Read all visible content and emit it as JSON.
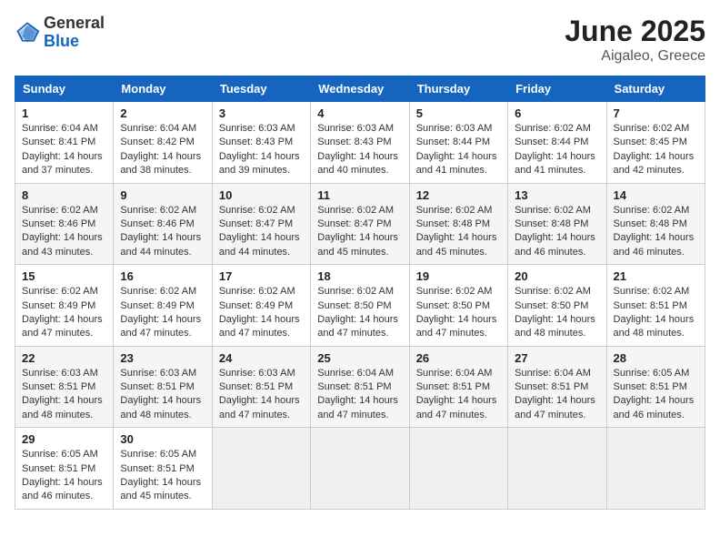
{
  "header": {
    "logo_general": "General",
    "logo_blue": "Blue",
    "month_year": "June 2025",
    "location": "Aigaleo, Greece"
  },
  "calendar": {
    "days_of_week": [
      "Sunday",
      "Monday",
      "Tuesday",
      "Wednesday",
      "Thursday",
      "Friday",
      "Saturday"
    ],
    "weeks": [
      [
        null,
        {
          "day": "2",
          "sunrise": "6:04 AM",
          "sunset": "8:42 PM",
          "daylight": "14 hours and 38 minutes."
        },
        {
          "day": "3",
          "sunrise": "6:03 AM",
          "sunset": "8:43 PM",
          "daylight": "14 hours and 39 minutes."
        },
        {
          "day": "4",
          "sunrise": "6:03 AM",
          "sunset": "8:43 PM",
          "daylight": "14 hours and 40 minutes."
        },
        {
          "day": "5",
          "sunrise": "6:03 AM",
          "sunset": "8:44 PM",
          "daylight": "14 hours and 41 minutes."
        },
        {
          "day": "6",
          "sunrise": "6:02 AM",
          "sunset": "8:44 PM",
          "daylight": "14 hours and 41 minutes."
        },
        {
          "day": "7",
          "sunrise": "6:02 AM",
          "sunset": "8:45 PM",
          "daylight": "14 hours and 42 minutes."
        }
      ],
      [
        {
          "day": "1",
          "sunrise": "6:04 AM",
          "sunset": "8:41 PM",
          "daylight": "14 hours and 37 minutes."
        },
        null,
        null,
        null,
        null,
        null,
        null
      ],
      [
        {
          "day": "8",
          "sunrise": "6:02 AM",
          "sunset": "8:46 PM",
          "daylight": "14 hours and 43 minutes."
        },
        {
          "day": "9",
          "sunrise": "6:02 AM",
          "sunset": "8:46 PM",
          "daylight": "14 hours and 44 minutes."
        },
        {
          "day": "10",
          "sunrise": "6:02 AM",
          "sunset": "8:47 PM",
          "daylight": "14 hours and 44 minutes."
        },
        {
          "day": "11",
          "sunrise": "6:02 AM",
          "sunset": "8:47 PM",
          "daylight": "14 hours and 45 minutes."
        },
        {
          "day": "12",
          "sunrise": "6:02 AM",
          "sunset": "8:48 PM",
          "daylight": "14 hours and 45 minutes."
        },
        {
          "day": "13",
          "sunrise": "6:02 AM",
          "sunset": "8:48 PM",
          "daylight": "14 hours and 46 minutes."
        },
        {
          "day": "14",
          "sunrise": "6:02 AM",
          "sunset": "8:48 PM",
          "daylight": "14 hours and 46 minutes."
        }
      ],
      [
        {
          "day": "15",
          "sunrise": "6:02 AM",
          "sunset": "8:49 PM",
          "daylight": "14 hours and 47 minutes."
        },
        {
          "day": "16",
          "sunrise": "6:02 AM",
          "sunset": "8:49 PM",
          "daylight": "14 hours and 47 minutes."
        },
        {
          "day": "17",
          "sunrise": "6:02 AM",
          "sunset": "8:49 PM",
          "daylight": "14 hours and 47 minutes."
        },
        {
          "day": "18",
          "sunrise": "6:02 AM",
          "sunset": "8:50 PM",
          "daylight": "14 hours and 47 minutes."
        },
        {
          "day": "19",
          "sunrise": "6:02 AM",
          "sunset": "8:50 PM",
          "daylight": "14 hours and 47 minutes."
        },
        {
          "day": "20",
          "sunrise": "6:02 AM",
          "sunset": "8:50 PM",
          "daylight": "14 hours and 48 minutes."
        },
        {
          "day": "21",
          "sunrise": "6:02 AM",
          "sunset": "8:51 PM",
          "daylight": "14 hours and 48 minutes."
        }
      ],
      [
        {
          "day": "22",
          "sunrise": "6:03 AM",
          "sunset": "8:51 PM",
          "daylight": "14 hours and 48 minutes."
        },
        {
          "day": "23",
          "sunrise": "6:03 AM",
          "sunset": "8:51 PM",
          "daylight": "14 hours and 48 minutes."
        },
        {
          "day": "24",
          "sunrise": "6:03 AM",
          "sunset": "8:51 PM",
          "daylight": "14 hours and 47 minutes."
        },
        {
          "day": "25",
          "sunrise": "6:04 AM",
          "sunset": "8:51 PM",
          "daylight": "14 hours and 47 minutes."
        },
        {
          "day": "26",
          "sunrise": "6:04 AM",
          "sunset": "8:51 PM",
          "daylight": "14 hours and 47 minutes."
        },
        {
          "day": "27",
          "sunrise": "6:04 AM",
          "sunset": "8:51 PM",
          "daylight": "14 hours and 47 minutes."
        },
        {
          "day": "28",
          "sunrise": "6:05 AM",
          "sunset": "8:51 PM",
          "daylight": "14 hours and 46 minutes."
        }
      ],
      [
        {
          "day": "29",
          "sunrise": "6:05 AM",
          "sunset": "8:51 PM",
          "daylight": "14 hours and 46 minutes."
        },
        {
          "day": "30",
          "sunrise": "6:05 AM",
          "sunset": "8:51 PM",
          "daylight": "14 hours and 45 minutes."
        },
        null,
        null,
        null,
        null,
        null
      ]
    ]
  }
}
